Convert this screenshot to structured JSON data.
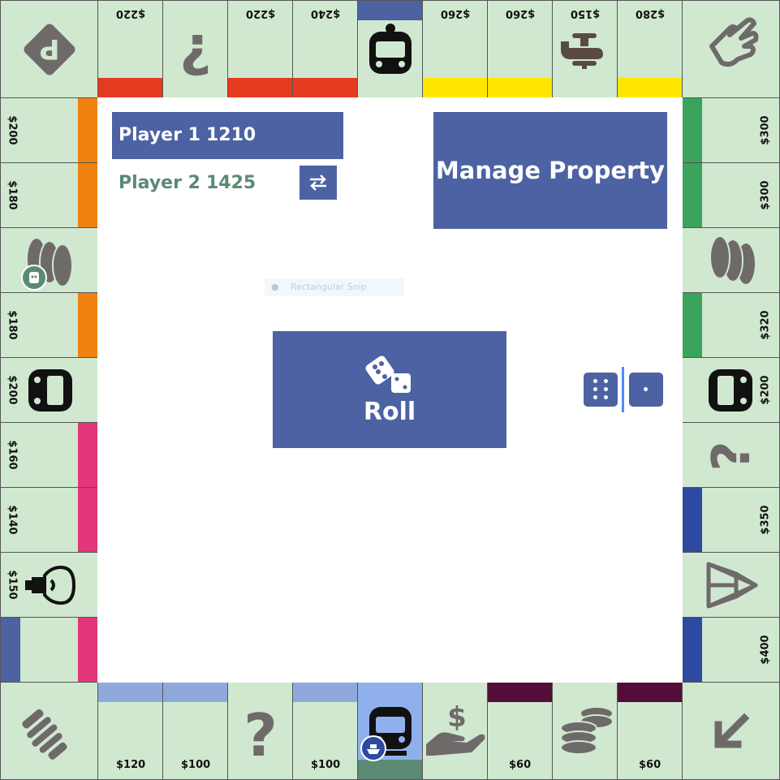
{
  "players": [
    {
      "name": "Player 1",
      "money": "1210",
      "active": true
    },
    {
      "name": "Player 2",
      "money": "1425",
      "active": false
    }
  ],
  "buttons": {
    "manage_label": "Manage Property",
    "roll_label": "Roll"
  },
  "snip": {
    "label": "Rectangular Snip"
  },
  "dice": [
    6,
    1
  ],
  "colors": {
    "tile": "#d0e8d0",
    "button": "#4c62a3",
    "player2_text": "#5a8a74",
    "icon_gray": "#6f6a6a",
    "red": "#e43a1f",
    "yellow": "#ffe600",
    "orange": "#f0820f",
    "pink": "#e1367a",
    "green": "#3aa45c",
    "darkblue": "#2d4aa0",
    "lightblue": "#8fa9dc",
    "purple": "#560c38"
  },
  "board": {
    "top": [
      "$220",
      "$220",
      "$240",
      "$260",
      "$260",
      "$150",
      "$280"
    ],
    "right": [
      "$300",
      "$300",
      "$320",
      "$200",
      "$350",
      "$400"
    ],
    "bottom": [
      "$120",
      "$100",
      "$100",
      "$60",
      "$60"
    ],
    "left": [
      "$200",
      "$180",
      "$180",
      "$200",
      "$160",
      "$140",
      "$150"
    ]
  }
}
